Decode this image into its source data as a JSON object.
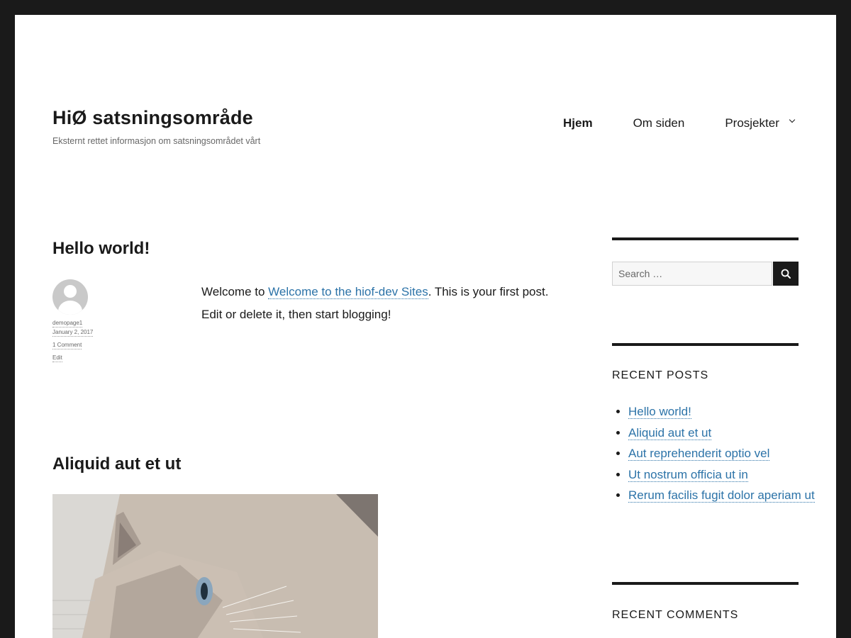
{
  "site": {
    "title": "HiØ satsningsområde",
    "description": "Eksternt rettet informasjon om satsningsområdet vårt"
  },
  "nav": {
    "items": [
      {
        "label": "Hjem"
      },
      {
        "label": "Om siden"
      },
      {
        "label": "Prosjekter"
      }
    ]
  },
  "posts": [
    {
      "title": "Hello world!",
      "author": "demopage1",
      "date": "January 2, 2017",
      "comments": "1 Comment",
      "edit": "Edit",
      "content_before": "Welcome to ",
      "content_link": "Welcome to the hiof-dev Sites",
      "content_after": ". This is your first post. Edit or delete it, then start blogging!"
    },
    {
      "title": "Aliquid aut et ut"
    }
  ],
  "sidebar": {
    "search_placeholder": "Search …",
    "recent_posts_title": "Recent Posts",
    "recent_posts": [
      "Hello world!",
      "Aliquid aut et ut",
      "Aut reprehenderit optio vel",
      "Ut nostrum officia ut in",
      "Rerum facilis fugit dolor aperiam ut"
    ],
    "recent_comments_title": "Recent Comments"
  },
  "colors": {
    "frame": "#1a1a1a",
    "link": "#2c73a8",
    "meta_text": "#686868"
  },
  "icons": {
    "search": "search-icon",
    "submenu": "chevron-down-icon",
    "avatar": "avatar-icon"
  }
}
